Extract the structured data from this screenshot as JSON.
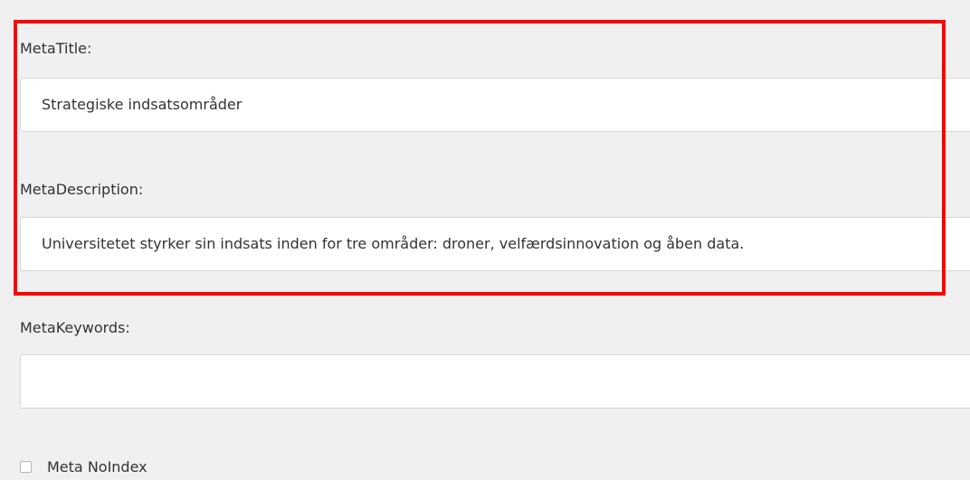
{
  "form": {
    "meta_title": {
      "label": "MetaTitle:",
      "value": "Strategiske indsatsområder"
    },
    "meta_description": {
      "label": "MetaDescription:",
      "value": "Universitetet styrker sin indsats inden for tre områder: droner, velfærdsinnovation og åben data."
    },
    "meta_keywords": {
      "label": "MetaKeywords:",
      "value": ""
    },
    "meta_noindex": {
      "label": "Meta NoIndex",
      "checked": false
    }
  },
  "colors": {
    "background": "#f0f0f0",
    "field_background": "#ffffff",
    "field_border": "#d7d7d7",
    "highlight": "#ff0000",
    "text": "#333333"
  }
}
